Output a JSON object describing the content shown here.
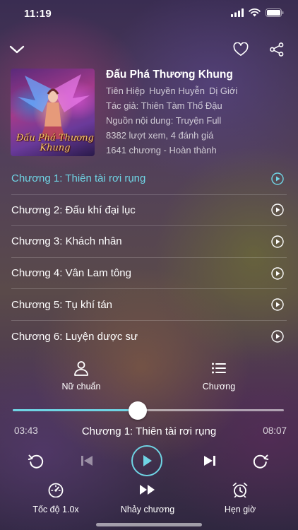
{
  "status": {
    "time": "11:19"
  },
  "book": {
    "title": "Đấu Phá Thương Khung",
    "cover_text": "Đấu Phá Thương Khung",
    "genres": [
      "Tiên Hiệp",
      "Huyền Huyễn",
      "Dị Giới"
    ],
    "author": "Tác giả: Thiên Tàm Thổ Đậu",
    "source": "Nguồn nội dung: Truyện Full",
    "stats": "8382 lượt xem, 4 đánh giá",
    "chapters_info": "1641 chương - Hoàn thành"
  },
  "chapters": [
    {
      "label": "Chương 1: Thiên tài rơi rụng"
    },
    {
      "label": "Chương 2: Đấu khí đại lục"
    },
    {
      "label": "Chương 3: Khách nhân"
    },
    {
      "label": "Chương 4: Vân Lam tông"
    },
    {
      "label": "Chương 5: Tụ khí tán"
    },
    {
      "label": "Chương 6: Luyện dược sư"
    }
  ],
  "modes": {
    "voice": "Nữ chuẩn",
    "chapter": "Chương"
  },
  "player": {
    "elapsed": "03:43",
    "duration": "08:07",
    "current_chapter": "Chương 1: Thiên tài rơi rụng",
    "progress": 0.46
  },
  "bottom": {
    "speed": "Tốc độ 1.0x",
    "skip": "Nhảy chương",
    "timer": "Hẹn giờ"
  },
  "colors": {
    "accent": "#6fd4e4"
  }
}
